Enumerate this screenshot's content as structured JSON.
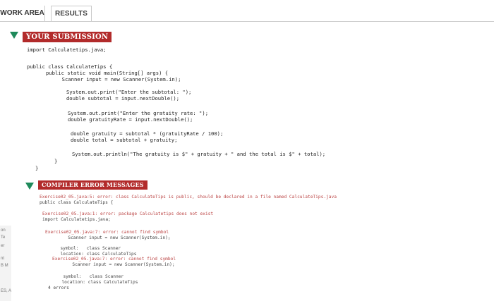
{
  "tabs": {
    "work_area": "WORK AREA",
    "results": "RESULTS"
  },
  "submission": {
    "title": "YOUR SUBMISSION",
    "code": [
      "import Calculatetips.java;",
      "",
      "public class CalculateTips {",
      "   public static void main(String[] args) {",
      "     Scanner input = new Scanner(System.in);",
      "",
      "      System.out.print(\"Enter the subtotal: \");",
      "      double subtotal = input.nextDouble();",
      "",
      "      System.out.print(\"Enter the gratuity rate: \");",
      "      double gratuityRate = input.nextDouble();",
      "",
      "      double gratuity = subtotal * (gratuityRate / 100);",
      "      double total = subtotal + gratuity;",
      "",
      "      System.out.println(\"The gratuity is $\" + gratuity + \" and the total is $\" + total);",
      "   }",
      "}"
    ]
  },
  "compiler": {
    "title": "COMPILER ERROR MESSAGES",
    "lines": [
      "Exercise02_05.java:5: error: class CalculateTips is public, should be declared in a file named CalculateTips.java",
      "public class CalculateTips {",
      "",
      "Exercise02_05.java:1: error: package Calculatetips does not exist",
      "import Calculatetips.java;",
      "",
      "Exercise02_05.java:7: error: cannot find symbol",
      "      Scanner input = new Scanner(System.in);",
      "",
      "  symbol:   class Scanner",
      "  location: class CalculateTips",
      "Exercise02_05.java:7: error: cannot find symbol",
      "      Scanner input = new Scanner(System.in);",
      "",
      "  symbol:   class Scanner",
      "  location: class CalculateTips",
      "4 errors"
    ]
  },
  "left_strip": [
    "on",
    "Te",
    "er",
    "nt",
    "B M",
    "ES, A"
  ]
}
